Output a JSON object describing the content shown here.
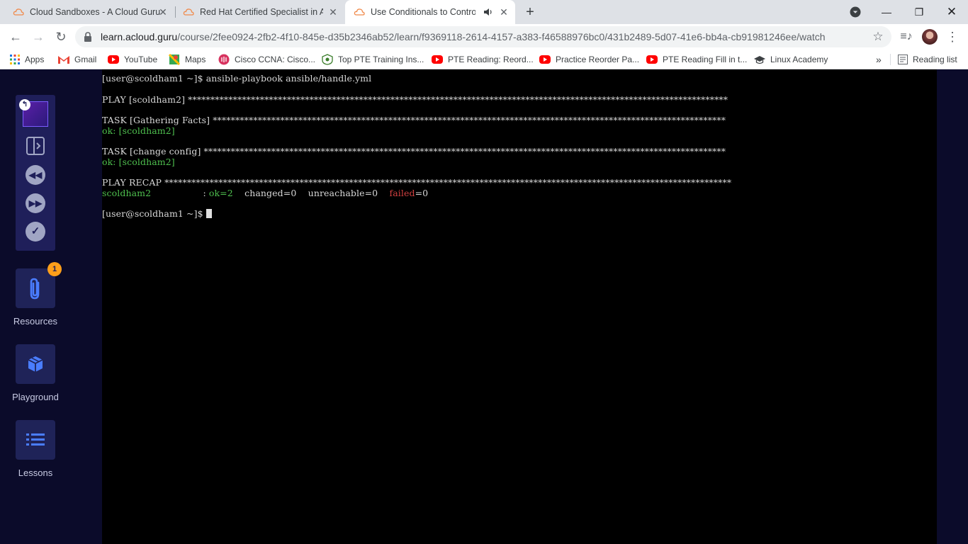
{
  "browser": {
    "tabs": [
      {
        "title": "Cloud Sandboxes - A Cloud Guru",
        "active": false
      },
      {
        "title": "Red Hat Certified Specialist in An",
        "active": false
      },
      {
        "title": "Use Conditionals to Control I",
        "active": true
      }
    ],
    "url": {
      "host": "learn.acloud.guru",
      "path": "/course/2fee0924-2fb2-4f10-845e-d35b2346ab52/learn/f9369118-2614-4157-a383-f46588976bc0/431b2489-5d07-41e6-bb4a-cb91981246ee/watch"
    },
    "bookmarks": [
      {
        "label": "Apps",
        "icon": "apps-grid-icon"
      },
      {
        "label": "Gmail",
        "icon": "gmail-icon"
      },
      {
        "label": "YouTube",
        "icon": "youtube-icon"
      },
      {
        "label": "Maps",
        "icon": "maps-icon"
      },
      {
        "label": "Cisco CCNA: Cisco...",
        "icon": "cisco-icon"
      },
      {
        "label": "Top PTE Training Ins...",
        "icon": "pte-icon"
      },
      {
        "label": "PTE Reading: Reord...",
        "icon": "youtube-icon"
      },
      {
        "label": "Practice Reorder Pa...",
        "icon": "youtube-icon"
      },
      {
        "label": "PTE Reading Fill in t...",
        "icon": "youtube-icon"
      },
      {
        "label": "Linux Academy",
        "icon": "graduation-cap-icon"
      }
    ],
    "bookmarks_overflow": "»",
    "reading_list": "Reading list"
  },
  "sidebar": {
    "resources_label": "Resources",
    "resources_badge": "1",
    "playground_label": "Playground",
    "lessons_label": "Lessons"
  },
  "terminal": {
    "line1": "[user@scoldham1 ~]$ ansible-playbook ansible/handle.yml",
    "play": "PLAY [scoldham2] ************************************************************************************************************************",
    "task1": "TASK [Gathering Facts] ******************************************************************************************************************",
    "ok1": "ok: [scoldham2]",
    "task2": "TASK [change config] ********************************************************************************************************************",
    "ok2": "ok: [scoldham2]",
    "recap": "PLAY RECAP ******************************************************************************************************************************",
    "recap_host": "scoldham2",
    "recap_sep": "                  : ",
    "recap_ok": "ok=2",
    "recap_changed": "    changed=0    unreachable=0    ",
    "recap_failed": "failed",
    "recap_failed_val": "=0",
    "prompt": "[user@scoldham1 ~]$ "
  },
  "colors": {
    "accent": "#1f1f5a",
    "terminal_green": "#4ebf4e",
    "terminal_red": "#d24040",
    "badge": "#ff9f1a"
  }
}
